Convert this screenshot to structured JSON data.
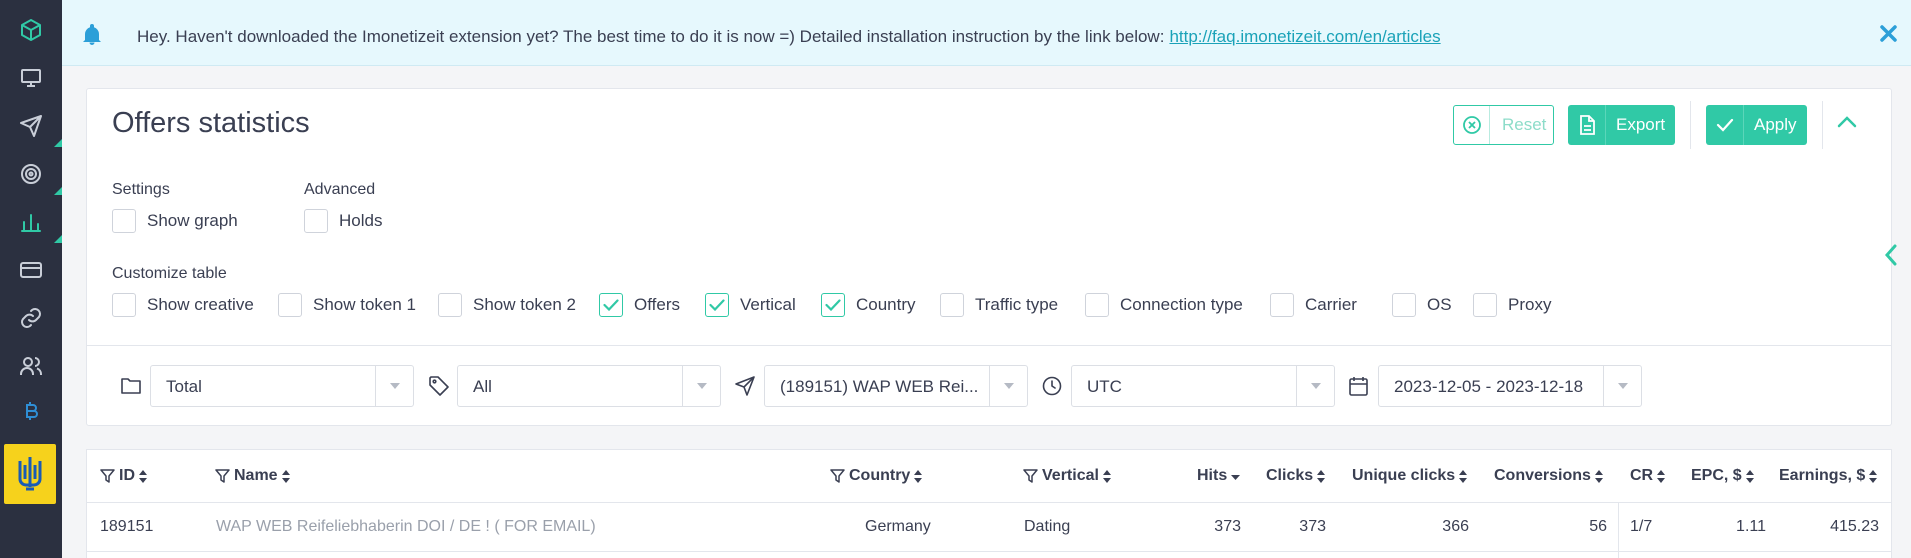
{
  "notice": {
    "text": "Hey. Haven't downloaded the Imonetizeit extension yet? The best time to do it is now =) Detailed installation instruction by the link below:",
    "link": "http://faq.imonetizeit.com/en/articles"
  },
  "colors": {
    "accent": "#30c9a6",
    "sidebar": "#2b3040",
    "notice_bg": "#e6f8fd",
    "flag_bg": "#f6d21c",
    "flag_trident": "#1a5bb5"
  },
  "sidebar_icons": [
    "cube-icon",
    "monitor-icon",
    "send-icon",
    "target-icon",
    "bar-chart-icon",
    "credit-card-icon",
    "link-icon",
    "users-icon",
    "bitcoin-icon",
    "ukraine-trident-icon"
  ],
  "page": {
    "title": "Offers statistics",
    "buttons": {
      "reset": "Reset",
      "export": "Export",
      "apply": "Apply"
    }
  },
  "settings": {
    "label": "Settings",
    "show_graph": {
      "label": "Show graph",
      "checked": false
    }
  },
  "advanced": {
    "label": "Advanced",
    "holds": {
      "label": "Holds",
      "checked": false
    }
  },
  "customize": {
    "label": "Customize table",
    "options": [
      {
        "label": "Show creative",
        "checked": false
      },
      {
        "label": "Show token 1",
        "checked": false
      },
      {
        "label": "Show token 2",
        "checked": false
      },
      {
        "label": "Offers",
        "checked": true
      },
      {
        "label": "Vertical",
        "checked": true
      },
      {
        "label": "Country",
        "checked": true
      },
      {
        "label": "Traffic type",
        "checked": false
      },
      {
        "label": "Connection type",
        "checked": false
      },
      {
        "label": "Carrier",
        "checked": false
      },
      {
        "label": "OS",
        "checked": false
      },
      {
        "label": "Proxy",
        "checked": false
      }
    ]
  },
  "filters": {
    "group": "Total",
    "tag": "All",
    "offer": "(189151) WAP WEB Rei...",
    "timezone": "UTC",
    "date_range": "2023-12-05 - 2023-12-18"
  },
  "table": {
    "headers": {
      "id": "ID",
      "name": "Name",
      "country": "Country",
      "vertical": "Vertical",
      "hits": "Hits",
      "clicks": "Clicks",
      "unique_clicks": "Unique clicks",
      "conversions": "Conversions",
      "cr": "CR",
      "epc": "EPC, $",
      "earnings": "Earnings, $"
    },
    "rows": [
      {
        "id": "189151",
        "name": "WAP WEB Reifeliebhaberin DOI / DE ! ( FOR EMAIL)",
        "country": "Germany",
        "vertical": "Dating",
        "hits": "373",
        "clicks": "373",
        "unique_clicks": "366",
        "conversions": "56",
        "cr": "1/7",
        "epc": "1.11",
        "earnings": "415.23"
      }
    ]
  }
}
